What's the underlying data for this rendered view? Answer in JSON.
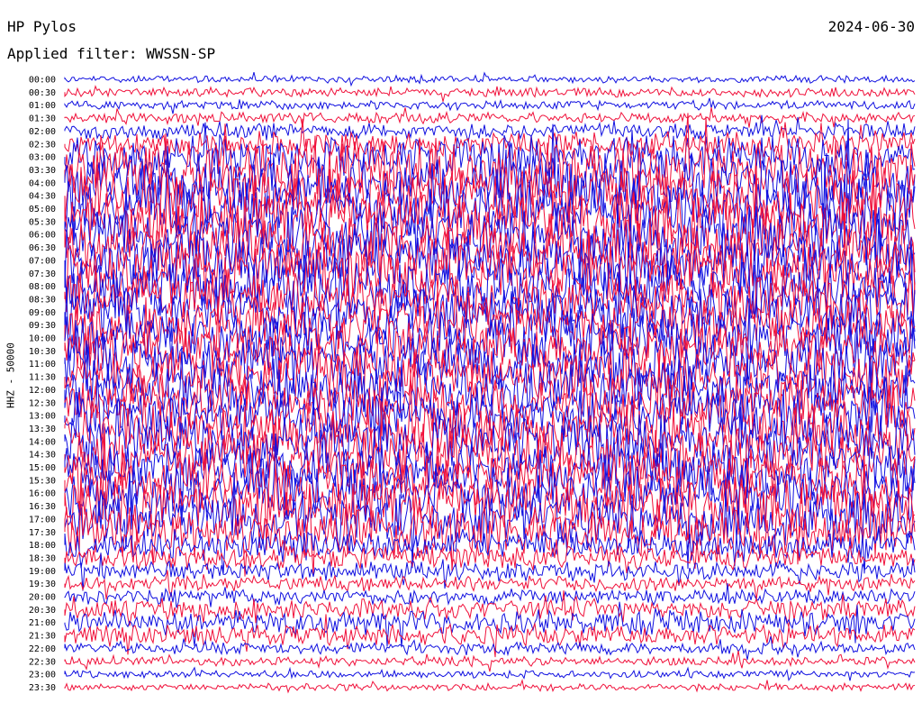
{
  "header": {
    "station": "HP Pylos",
    "date": "2024-06-30",
    "filter": "Applied filter: WWSSN-SP"
  },
  "colors": {
    "trace_a": "#1010e0",
    "trace_b": "#f0103a"
  },
  "chart_data": {
    "type": "line",
    "ylabel": "HHZ - 50000",
    "row_labels": [
      "00:00",
      "00:30",
      "01:00",
      "01:30",
      "02:00",
      "02:30",
      "03:00",
      "03:30",
      "04:00",
      "04:30",
      "05:00",
      "05:30",
      "06:00",
      "06:30",
      "07:00",
      "07:30",
      "08:00",
      "08:30",
      "09:00",
      "09:30",
      "10:00",
      "10:30",
      "11:00",
      "11:30",
      "12:00",
      "12:30",
      "13:00",
      "13:30",
      "14:00",
      "14:30",
      "15:00",
      "15:30",
      "16:00",
      "16:30",
      "17:00",
      "17:30",
      "18:00",
      "18:30",
      "19:00",
      "19:30",
      "20:00",
      "20:30",
      "21:00",
      "21:30",
      "22:00",
      "22:30",
      "23:00",
      "23:30"
    ],
    "row_amplitude": [
      0.12,
      0.15,
      0.15,
      0.18,
      0.25,
      0.4,
      0.7,
      1.0,
      1.0,
      1.0,
      1.0,
      1.0,
      1.0,
      1.0,
      1.0,
      1.0,
      0.9,
      0.9,
      0.9,
      0.9,
      0.9,
      0.9,
      0.9,
      0.9,
      0.9,
      0.9,
      0.9,
      0.9,
      0.9,
      0.9,
      0.9,
      0.9,
      0.9,
      0.9,
      0.9,
      0.8,
      0.5,
      0.4,
      0.3,
      0.25,
      0.25,
      0.35,
      0.4,
      0.35,
      0.2,
      0.15,
      0.12,
      0.12
    ]
  }
}
